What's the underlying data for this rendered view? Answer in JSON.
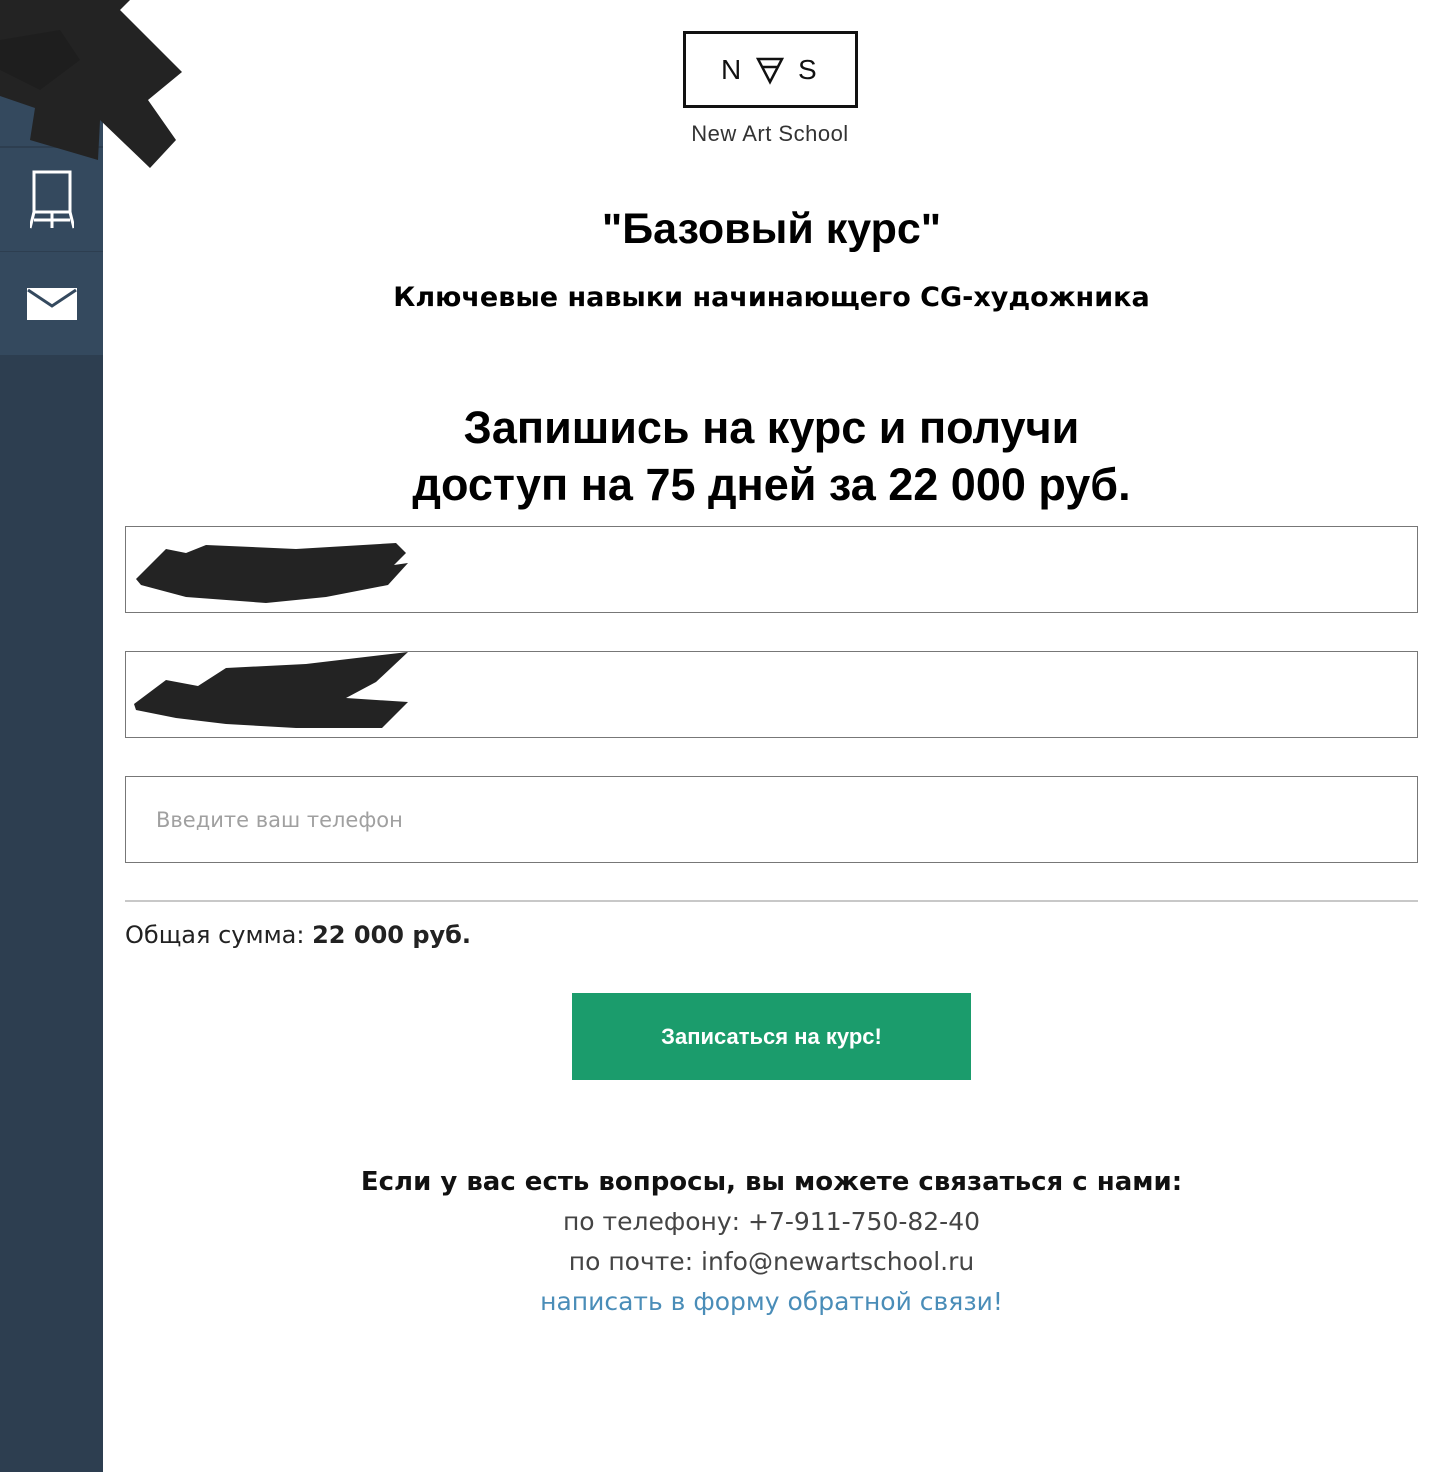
{
  "sidebar": {
    "items": [
      {
        "icon": "menu-icon"
      },
      {
        "icon": "easel-icon"
      },
      {
        "icon": "mail-icon"
      }
    ]
  },
  "logo": {
    "mark": "N ∀ S",
    "name": "New Art School"
  },
  "course": {
    "title": "\"Базовый курс\"",
    "subtitle": "Ключевые навыки начинающего CG-художника",
    "headline_line1": "Запишись на курс и получи",
    "headline_line2": "доступ на 75 дней за 22 000 руб."
  },
  "form": {
    "name_value": "",
    "email_value": "",
    "phone_placeholder": "Введите ваш телефон",
    "total_label": "Общая сумма: ",
    "total_value": "22 000 руб.",
    "submit_label": "Записаться на курс!"
  },
  "contacts": {
    "question": "Если у вас есть вопросы, вы можете связаться с нами:",
    "phone": "по телефону: +7-911-750-82-40",
    "email": "по почте: info@newartschool.ru",
    "feedback_link": "написать в форму обратной связи!"
  },
  "colors": {
    "sidebar": "#2d3e50",
    "sidebar_button": "#34495e",
    "accent": "#1b9c6c",
    "link": "#4a8db8"
  }
}
